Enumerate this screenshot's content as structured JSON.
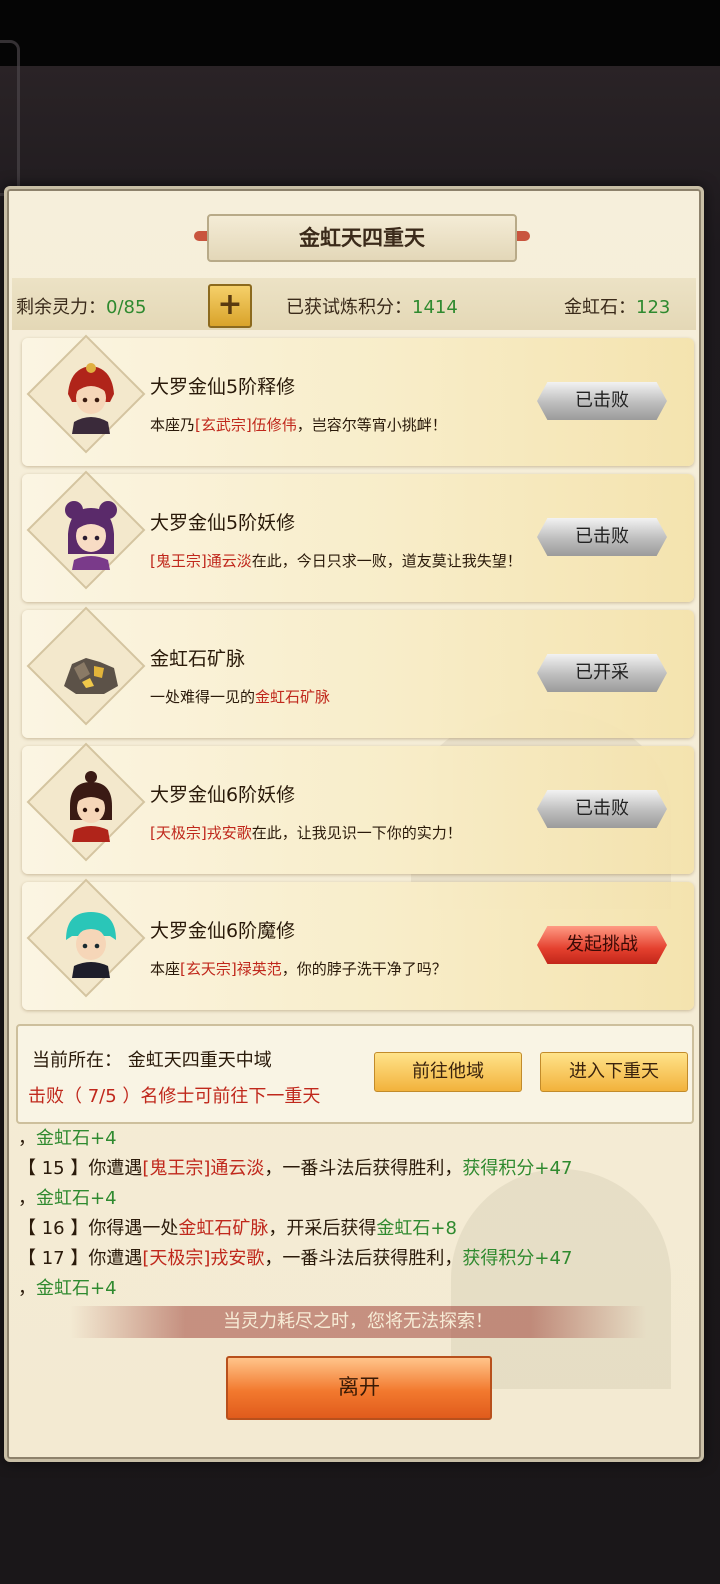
{
  "title": "金虹天四重天",
  "stats": {
    "spirit_label": "剩余灵力：",
    "spirit_value": "0/85",
    "plus_label": "+",
    "score_label": "已获试炼积分：",
    "score_value": "1414",
    "stone_label": "金虹石：",
    "stone_value": "123"
  },
  "cards": [
    {
      "name": "大罗金仙5阶释修",
      "desc_pre": "本座乃",
      "desc_hl": "[玄武宗]伍修伟",
      "desc_post": "，岂容尔等宵小挑衅！",
      "button": "已击败",
      "button_style": "gray",
      "avatar": "red-hair-warrior"
    },
    {
      "name": "大罗金仙5阶妖修",
      "desc_pre": "",
      "desc_hl": "[鬼王宗]通云淡",
      "desc_post": "在此，今日只求一败，道友莫让我失望！",
      "button": "已击败",
      "button_style": "gray",
      "avatar": "purple-hair-maiden"
    },
    {
      "name": "金虹石矿脉",
      "desc_pre": "一处难得一见的",
      "desc_hl": "金虹石矿脉",
      "desc_post": "",
      "button": "已开采",
      "button_style": "gray",
      "avatar": "ore-vein"
    },
    {
      "name": "大罗金仙6阶妖修",
      "desc_pre": "",
      "desc_hl": "[天极宗]戎安歌",
      "desc_post": "在此，让我见识一下你的实力！",
      "button": "已击败",
      "button_style": "gray",
      "avatar": "bun-hair-warrior"
    },
    {
      "name": "大罗金仙6阶魔修",
      "desc_pre": "本座",
      "desc_hl": "[玄天宗]禄英范",
      "desc_post": "，你的脖子洗干净了吗？",
      "button": "发起挑战",
      "button_style": "red",
      "avatar": "teal-hair-youth"
    }
  ],
  "location": {
    "current": "当前所在：  金虹天四重天中域",
    "requirement": "击败（ 7/5 ）名修士可前往下一重天",
    "go_other": "前往他域",
    "go_next": "进入下重天"
  },
  "log": [
    {
      "segs": [
        {
          "t": "，",
          "c": ""
        },
        {
          "t": "金虹石+4",
          "c": "g"
        }
      ]
    },
    {
      "segs": [
        {
          "t": "【 15 】你遭遇",
          "c": ""
        },
        {
          "t": "[鬼王宗]通云淡",
          "c": "r"
        },
        {
          "t": "，一番斗法后获得胜利，",
          "c": ""
        },
        {
          "t": "获得积分+47",
          "c": "g"
        }
      ]
    },
    {
      "segs": [
        {
          "t": "，",
          "c": ""
        },
        {
          "t": "金虹石+4",
          "c": "g"
        }
      ]
    },
    {
      "segs": [
        {
          "t": "【 16 】你得遇一处",
          "c": ""
        },
        {
          "t": "金虹石矿脉",
          "c": "r"
        },
        {
          "t": "，开采后获得",
          "c": ""
        },
        {
          "t": "金虹石+8",
          "c": "g"
        }
      ]
    },
    {
      "segs": [
        {
          "t": "【 17 】你遭遇",
          "c": ""
        },
        {
          "t": "[天极宗]戎安歌",
          "c": "r"
        },
        {
          "t": "，一番斗法后获得胜利，",
          "c": ""
        },
        {
          "t": "获得积分+47",
          "c": "g"
        }
      ]
    },
    {
      "segs": [
        {
          "t": "，",
          "c": ""
        },
        {
          "t": "金虹石+4",
          "c": "g"
        }
      ]
    }
  ],
  "warning": "当灵力耗尽之时，您将无法探索！",
  "leave_button": "离开"
}
